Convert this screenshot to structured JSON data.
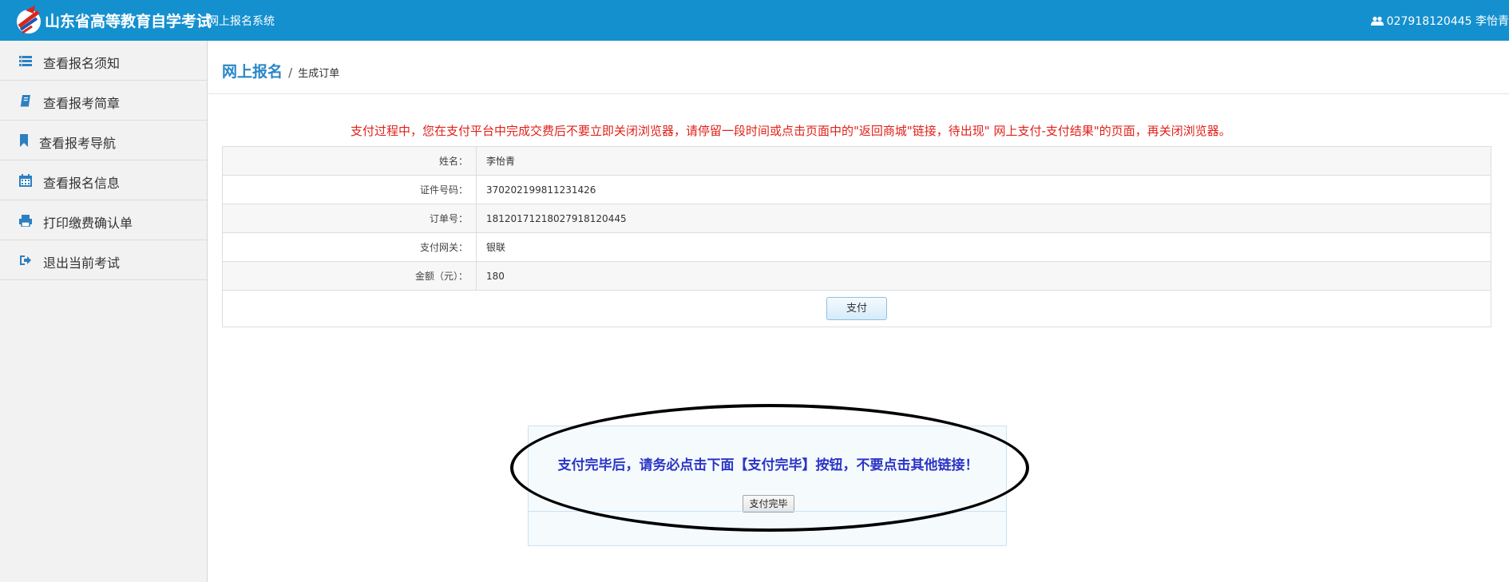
{
  "header": {
    "title": "山东省高等教育自学考试",
    "subtitle": "网上报名系统",
    "user": "027918120445 李怡青"
  },
  "sidebar": {
    "items": [
      {
        "label": "查看报名须知",
        "icon": "list-icon"
      },
      {
        "label": "查看报考简章",
        "icon": "book-icon"
      },
      {
        "label": "查看报考导航",
        "icon": "bookmark-icon"
      },
      {
        "label": "查看报名信息",
        "icon": "calendar-icon"
      },
      {
        "label": "打印缴费确认单",
        "icon": "print-icon"
      },
      {
        "label": "退出当前考试",
        "icon": "sign-out-icon"
      }
    ]
  },
  "breadcrumb": {
    "main": "网上报名",
    "separator": "/",
    "sub": "生成订单"
  },
  "warning": "支付过程中，您在支付平台中完成交费后不要立即关闭浏览器，请停留一段时间或点击页面中的\"返回商城\"链接，待出现\" 网上支付-支付结果\"的页面，再关闭浏览器。",
  "order": {
    "rows": [
      {
        "label": "姓名：",
        "value": "李怡青"
      },
      {
        "label": "证件号码：",
        "value": "370202199811231426"
      },
      {
        "label": "订单号：",
        "value": "18120171218027918120445"
      },
      {
        "label": "支付网关：",
        "value": "银联"
      },
      {
        "label": "金额（元）：",
        "value": "180"
      }
    ],
    "pay_button": "支付"
  },
  "notice": {
    "message": "支付完毕后，请务必点击下面【支付完毕】按钮，不要点击其他链接！",
    "done_button": "支付完毕"
  },
  "colors": {
    "topbar": "#1590cf",
    "warning": "#e0211a",
    "notice": "#2b35c6",
    "breadcrumb": "#2a87c7"
  }
}
